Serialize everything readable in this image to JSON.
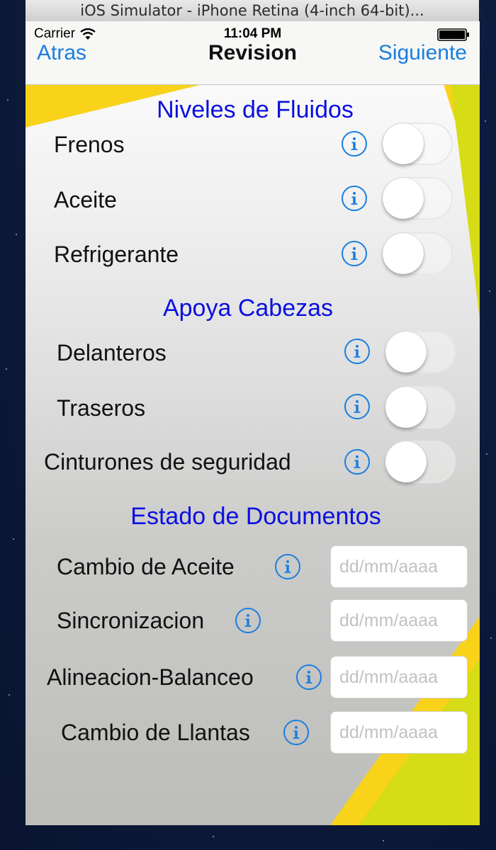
{
  "window": {
    "title": "iOS Simulator - iPhone Retina (4-inch 64-bit)..."
  },
  "status_bar": {
    "carrier": "Carrier",
    "time": "11:04 PM",
    "wifi_icon": "wifi-icon",
    "battery_icon": "battery-icon"
  },
  "nav": {
    "back_label": "Atras",
    "title": "Revision",
    "next_label": "Siguiente"
  },
  "colors": {
    "accent": "#1a7ee0",
    "section_title": "#0a10e0",
    "yellow": "#f9d21a",
    "green_yellow": "#d6dc16"
  },
  "sections": {
    "fluids": {
      "title": "Niveles de Fluidos",
      "items": [
        {
          "label": "Frenos",
          "checked": false
        },
        {
          "label": "Aceite",
          "checked": false
        },
        {
          "label": "Refrigerante",
          "checked": false
        }
      ]
    },
    "headrests": {
      "title": "Apoya Cabezas",
      "items": [
        {
          "label": "Delanteros",
          "checked": false
        },
        {
          "label": "Traseros",
          "checked": false
        },
        {
          "label": "Cinturones de seguridad",
          "checked": false
        }
      ]
    },
    "documents": {
      "title": "Estado de Documentos",
      "items": [
        {
          "label": "Cambio de Aceite",
          "value": "",
          "placeholder": "dd/mm/aaaa"
        },
        {
          "label": "Sincronizacion",
          "value": "",
          "placeholder": "dd/mm/aaaa"
        },
        {
          "label": "Alineacion-Balanceo",
          "value": "",
          "placeholder": "dd/mm/aaaa"
        },
        {
          "label": "Cambio de Llantas",
          "value": "",
          "placeholder": "dd/mm/aaaa"
        }
      ]
    }
  }
}
